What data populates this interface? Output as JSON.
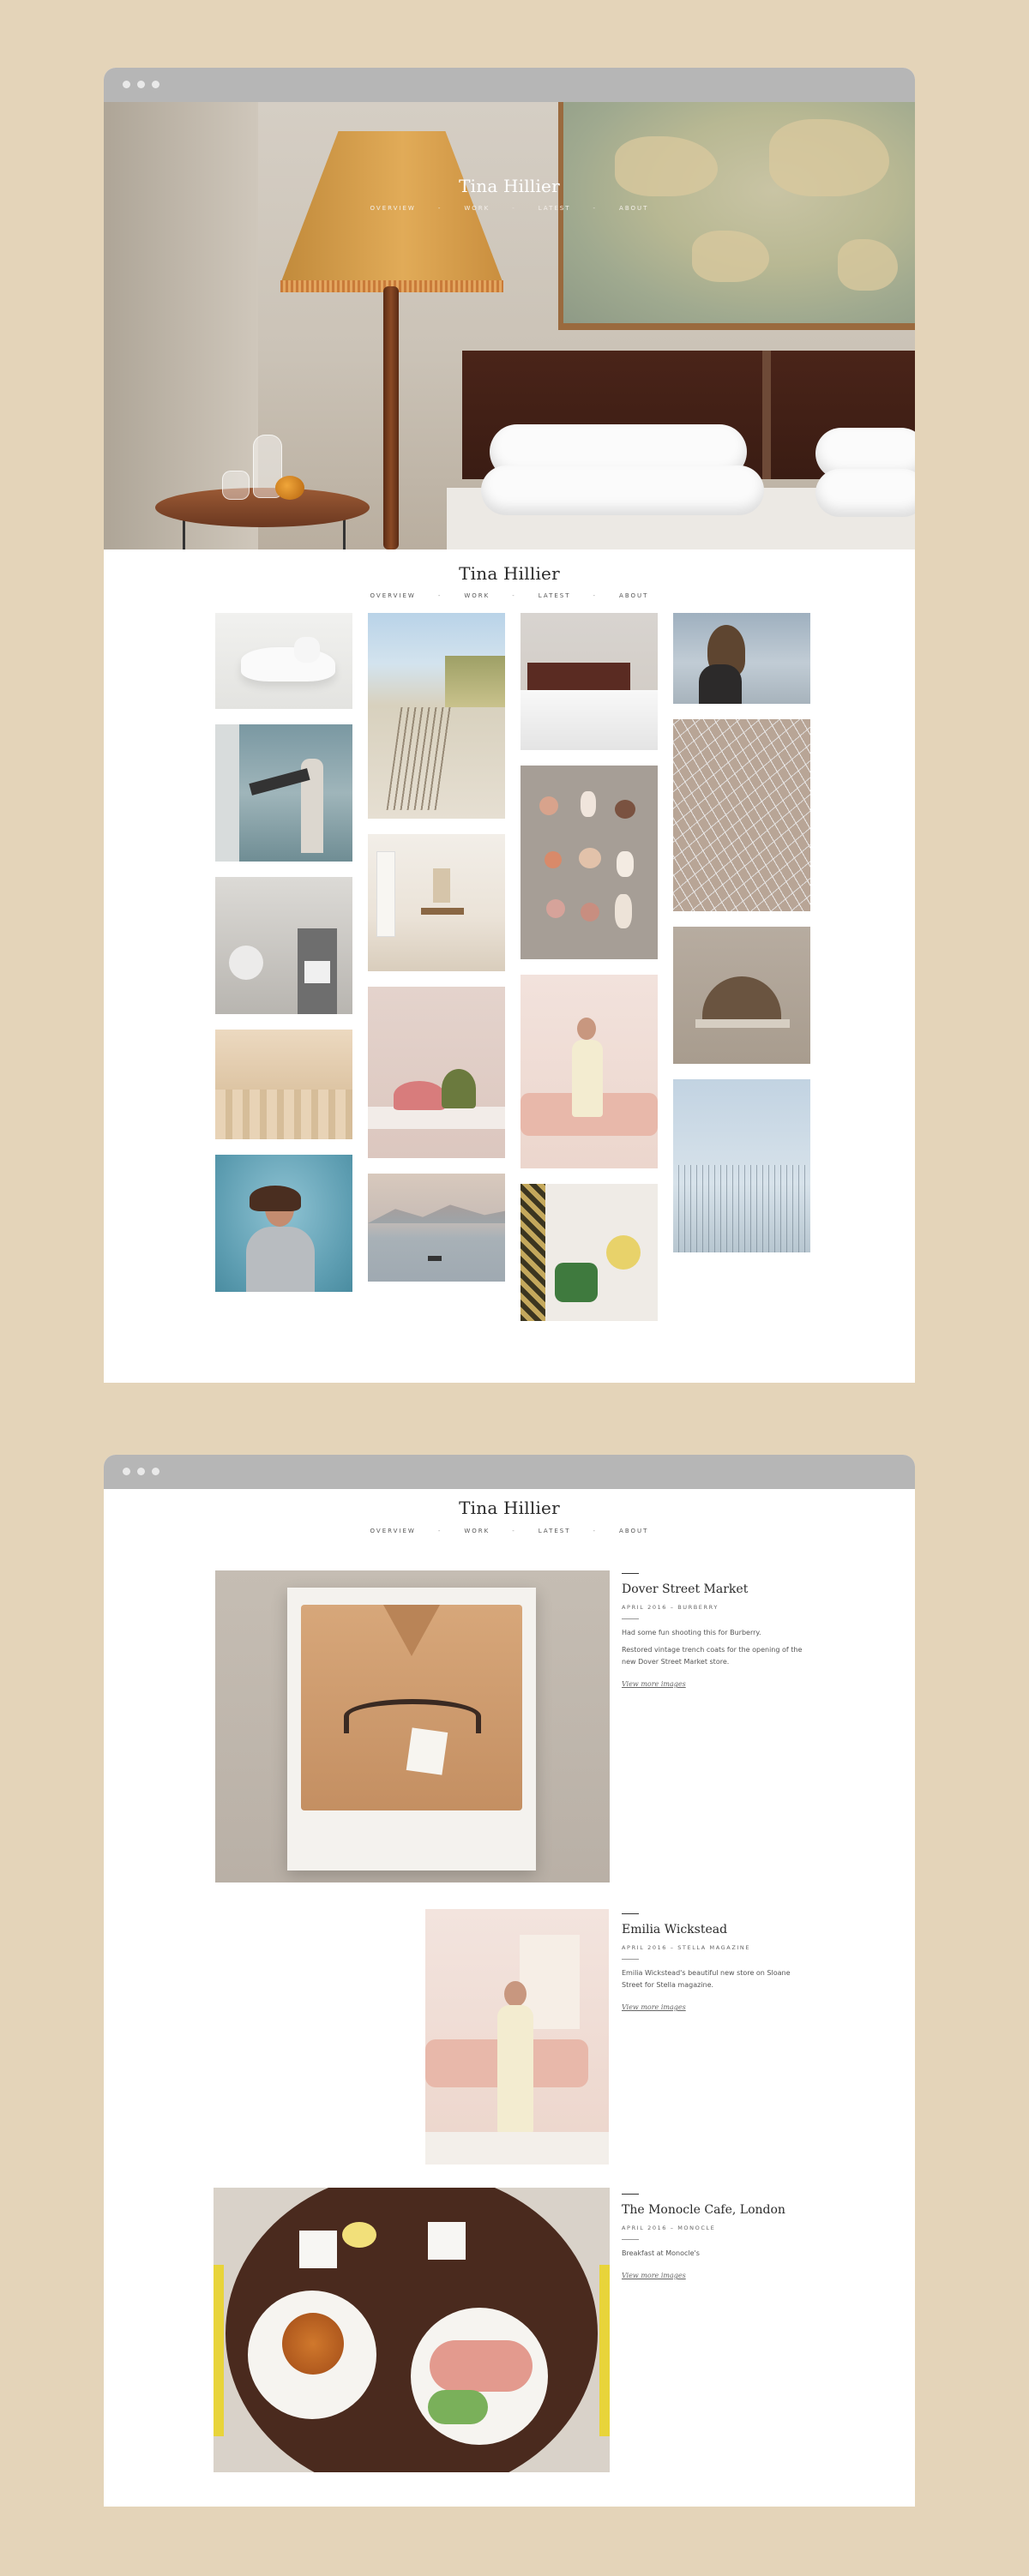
{
  "site": {
    "title": "Tina Hillier"
  },
  "nav": {
    "overview": "OVERVIEW",
    "work": "WORK",
    "latest": "LATEST",
    "about": "ABOUT",
    "separator": "-"
  },
  "posts": [
    {
      "title": "Dover Street Market",
      "meta": "APRIL 2016 – BURBERRY",
      "paragraphs": [
        "Had some fun shooting this for Burberry.",
        "Restored vintage trench coats for the opening of the new Dover Street Market store."
      ],
      "link": "View more images"
    },
    {
      "title": "Emilia Wickstead",
      "meta": "APRIL 2016 – STELLA MAGAZINE",
      "paragraphs": [
        "Emilia Wickstead's beautiful new store on Sloane Street for Stella magazine."
      ],
      "link": "View more images"
    },
    {
      "title": "The Monocle Cafe, London",
      "meta": "APRIL 2016 – MONOCLE",
      "paragraphs": [
        "Breakfast at Monocle's"
      ],
      "link": "View more images"
    }
  ],
  "colors": {
    "background": "#e4d4b9",
    "chrome": "#b6b6b6",
    "page": "#ffffff",
    "text": "#222222"
  },
  "icons": {
    "window_controls": "three-dot-window-controls"
  }
}
